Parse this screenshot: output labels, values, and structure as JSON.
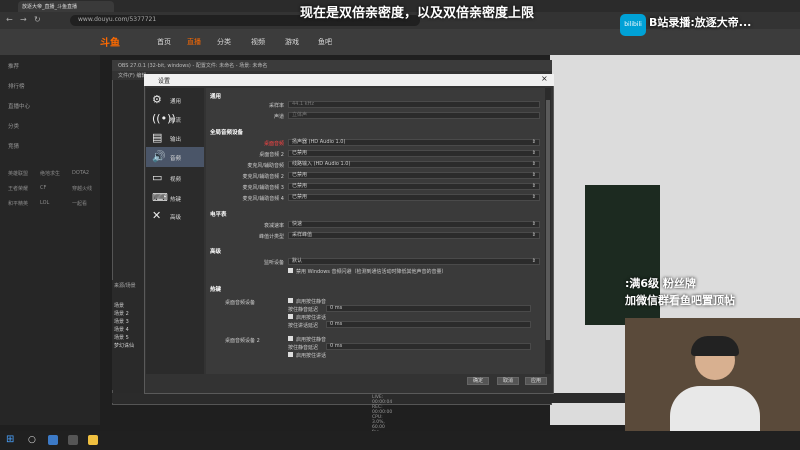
{
  "overlay_top": "现在是双倍亲密度，以及双倍亲密度上限",
  "bili_title": "B站录播:放逐大帝...",
  "bili_icon_label": "bilibili",
  "promo_line1": ":满6级 粉丝牌",
  "promo_line2": "加微信群看鱼吧置顶帖",
  "browser": {
    "tab_title": "放逐大帝_直播_斗鱼直播",
    "url": "www.douyu.com/5377721"
  },
  "site": {
    "logo": "斗鱼",
    "nav": [
      "首页",
      "直播",
      "分类",
      "视频",
      "游戏",
      "鱼吧"
    ]
  },
  "obs": {
    "window_title": "OBS 27.0.1 (32-bit, windows) - 配置文件: 未命名 - 场景: 未命名",
    "menu": "文件(F)  编辑"
  },
  "settings": {
    "title": "设置",
    "close": "×",
    "nav": [
      "通用",
      "推流",
      "输出",
      "音频",
      "视频",
      "热键",
      "高级"
    ],
    "sec_general": "通用",
    "rows_general": [
      {
        "label": "采样率",
        "value": "44.1 kHz"
      },
      {
        "label": "声道",
        "value": "立体声"
      }
    ],
    "sec_global": "全局音频设备",
    "rows_global": [
      {
        "label": "桌面音频",
        "value": "扬声器 (HD Audio 1.0)"
      },
      {
        "label": "桌面音频 2",
        "value": "已禁用"
      },
      {
        "label": "麦克风/辅助音频",
        "value": "线路输入 (HD Audio 1.0)"
      },
      {
        "label": "麦克风/辅助音频 2",
        "value": "已禁用"
      },
      {
        "label": "麦克风/辅助音频 3",
        "value": "已禁用"
      },
      {
        "label": "麦克风/辅助音频 4",
        "value": "已禁用"
      }
    ],
    "sec_meter": "电平表",
    "rows_meter": [
      {
        "label": "衰减速率",
        "value": "快速"
      },
      {
        "label": "峰值计类型",
        "value": "采样峰值"
      }
    ],
    "sec_adv": "高级",
    "rows_adv": [
      {
        "label": "监听设备",
        "value": "默认"
      }
    ],
    "checkbox_ducking": "禁用 Windows 音频闪避（检测到通信活动时降低其他声音的音量）",
    "sec_hotkeys": "热键",
    "hotkey_group1": "桌面音频设备",
    "hotkey_group2": "桌面音频设备 2",
    "hk_enable_ptm": "启用按住静音",
    "hk_ptm_delay": "按住静音延迟",
    "hk_enable_ptt": "启用按住讲话",
    "hk_ptt_delay": "按住讲话延迟",
    "hk_delay_value": "0 ms",
    "buttons": [
      "确定",
      "取消",
      "应用"
    ]
  },
  "scenes_header": "来源/场景",
  "scenes": [
    "场景",
    "场景 2",
    "场景 3",
    "场景 4",
    "场景 5",
    "梦幻诛仙"
  ],
  "statusbar": "LIVE: 00:00:04   REC: 00:00:00   CPU: 3.0%, 60.00 fps   kb/s: 0",
  "sidebar": [
    "推荐",
    "排行榜",
    "直播中心",
    "分类",
    "竞猜"
  ],
  "sidebar_grid": [
    "英雄联盟",
    "绝地求生",
    "DOTA2",
    "王者荣耀",
    "CF",
    "穿越火线",
    "和平精英",
    "LOL",
    "一起看"
  ],
  "colors": {
    "accent": "#ff6a00",
    "bili": "#00a1d6"
  }
}
